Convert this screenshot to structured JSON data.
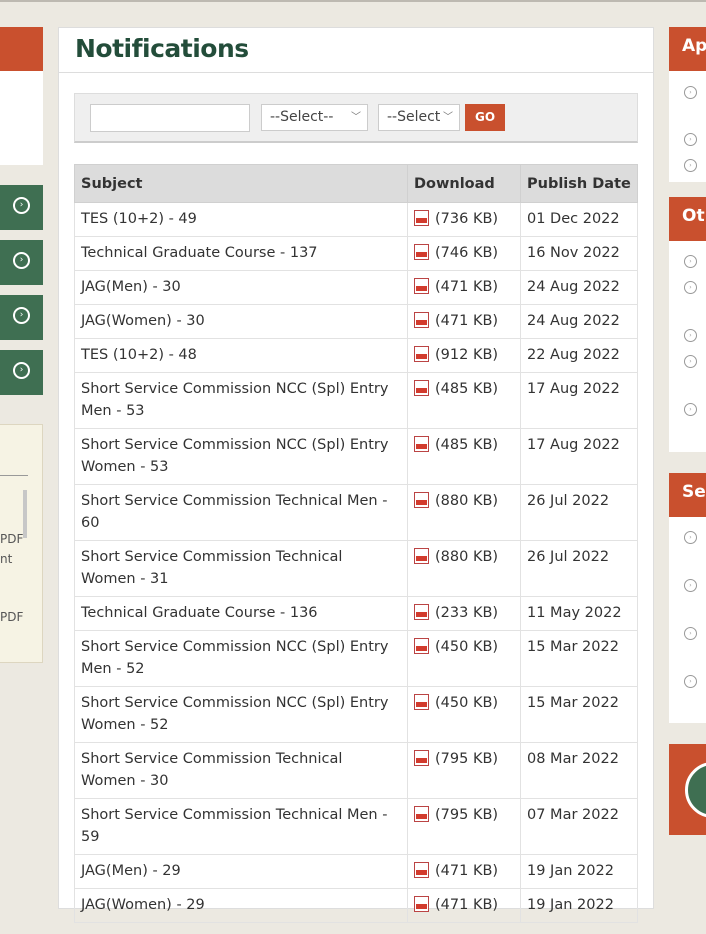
{
  "page_title": "Notifications",
  "filter": {
    "search_value": "",
    "select1": "--Select--",
    "select2": "--Select",
    "go_label": "GO"
  },
  "table": {
    "headers": [
      "Subject",
      "Download",
      "Publish Date"
    ],
    "rows": [
      {
        "subject": "TES (10+2) - 49",
        "size": "(736 KB)",
        "date": "01 Dec 2022"
      },
      {
        "subject": "Technical Graduate Course - 137",
        "size": "(746 KB)",
        "date": "16 Nov 2022"
      },
      {
        "subject": "JAG(Men) - 30",
        "size": "(471 KB)",
        "date": "24 Aug 2022"
      },
      {
        "subject": "JAG(Women) - 30",
        "size": "(471 KB)",
        "date": "24 Aug 2022"
      },
      {
        "subject": "TES (10+2) - 48",
        "size": "(912 KB)",
        "date": "22 Aug 2022"
      },
      {
        "subject": "Short Service Commission NCC (Spl) Entry Men - 53",
        "size": "(485 KB)",
        "date": "17 Aug 2022"
      },
      {
        "subject": "Short Service Commission NCC (Spl) Entry Women - 53",
        "size": "(485 KB)",
        "date": "17 Aug 2022"
      },
      {
        "subject": "Short Service Commission Technical Men - 60",
        "size": "(880 KB)",
        "date": "26 Jul 2022"
      },
      {
        "subject": "Short Service Commission Technical Women - 31",
        "size": "(880 KB)",
        "date": "26 Jul 2022"
      },
      {
        "subject": "Technical Graduate Course - 136",
        "size": "(233 KB)",
        "date": "11 May 2022"
      },
      {
        "subject": "Short Service Commission NCC (Spl) Entry Men - 52",
        "size": "(450 KB)",
        "date": "15 Mar 2022"
      },
      {
        "subject": "Short Service Commission NCC (Spl) Entry Women - 52",
        "size": "(450 KB)",
        "date": "15 Mar 2022"
      },
      {
        "subject": "Short Service Commission Technical Women - 30",
        "size": "(795 KB)",
        "date": "08 Mar 2022"
      },
      {
        "subject": "Short Service Commission Technical Men - 59",
        "size": "(795 KB)",
        "date": "07 Mar 2022"
      },
      {
        "subject": "JAG(Men) - 29",
        "size": "(471 KB)",
        "date": "19 Jan 2022"
      },
      {
        "subject": "JAG(Women) - 29",
        "size": "(471 KB)",
        "date": "19 Jan 2022"
      }
    ]
  },
  "left_column": {
    "fragments": [
      "PDF",
      "nt",
      "PDF"
    ]
  },
  "right_column": {
    "headings": [
      "Ap",
      "Oth",
      "Sel"
    ]
  },
  "colors": {
    "accent_orange": "#c9502e",
    "accent_green": "#3f6f52",
    "title_green": "#234d3a",
    "background": "#ece9e1"
  },
  "icons": {
    "download": "pdf-icon",
    "bullet": "circle-chevron-right-icon"
  }
}
